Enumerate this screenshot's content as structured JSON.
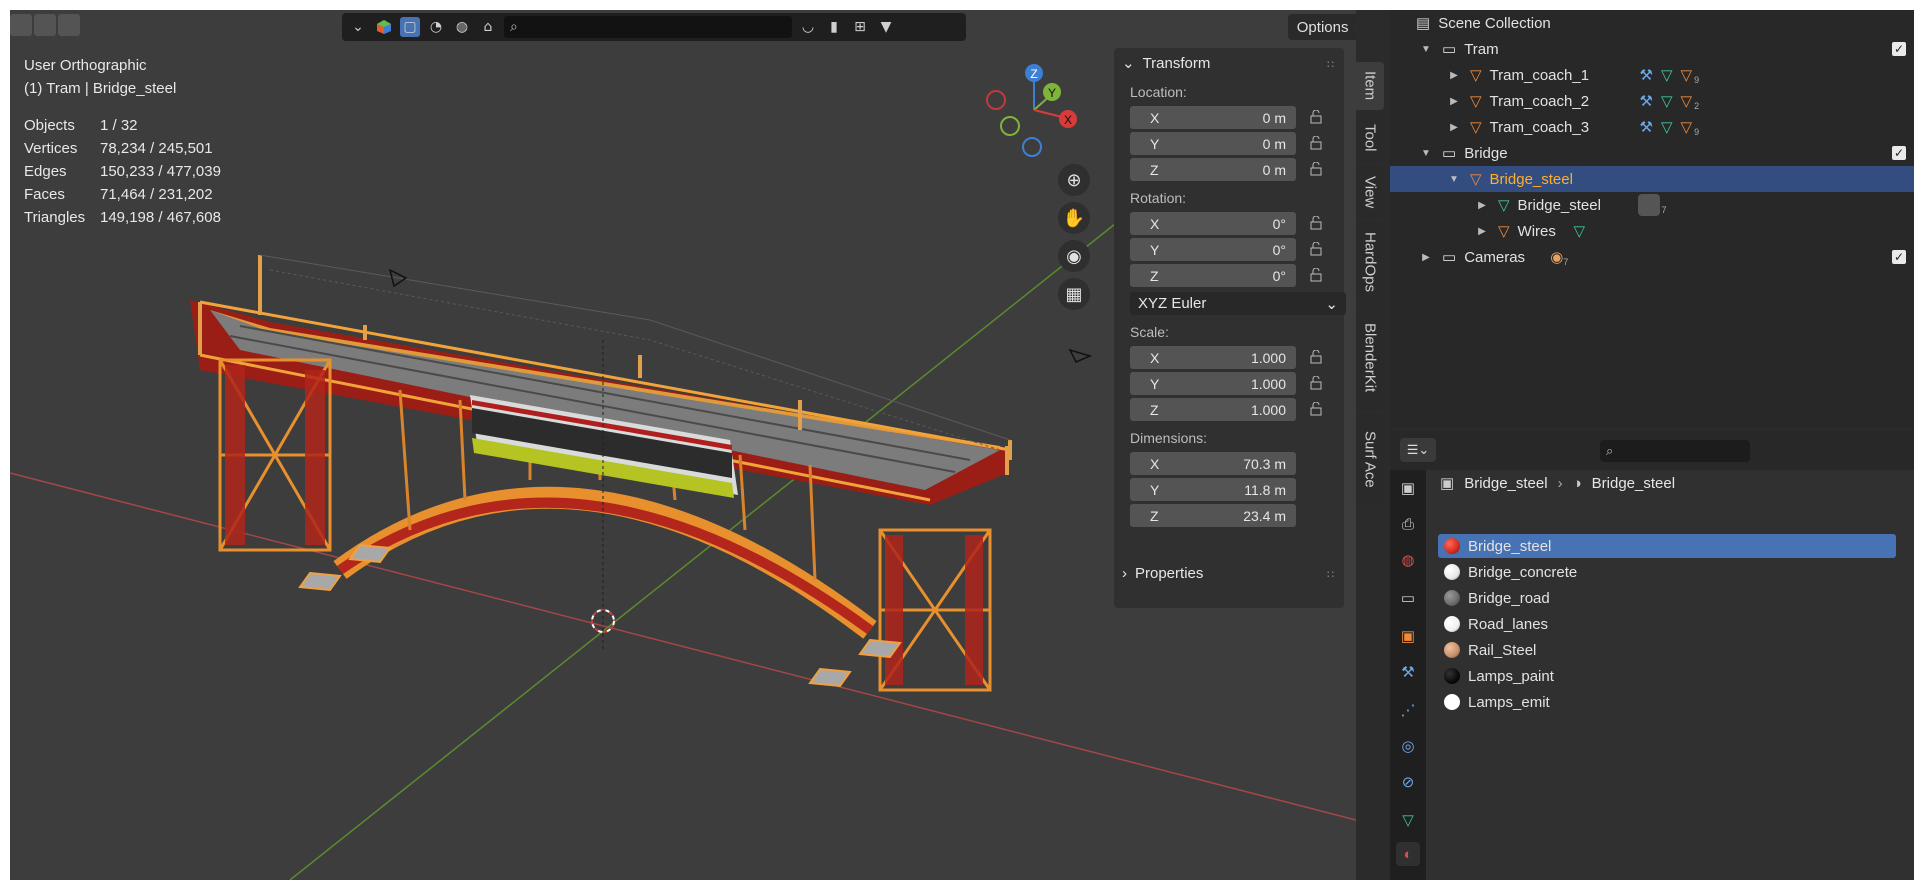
{
  "viewport": {
    "view_name": "User Orthographic",
    "context": "(1) Tram | Bridge_steel",
    "stats": [
      {
        "label": "Objects",
        "value": "1 / 32"
      },
      {
        "label": "Vertices",
        "value": "78,234 / 245,501"
      },
      {
        "label": "Edges",
        "value": "150,233 / 477,039"
      },
      {
        "label": "Faces",
        "value": "71,464 / 231,202"
      },
      {
        "label": "Triangles",
        "value": "149,198 / 467,608"
      }
    ],
    "options_label": "Options",
    "gizmo_axes": {
      "z": "Z",
      "y": "Y",
      "x": "X"
    }
  },
  "npanel": {
    "transform_title": "Transform",
    "location_label": "Location:",
    "location": [
      {
        "axis": "X",
        "value": "0 m"
      },
      {
        "axis": "Y",
        "value": "0 m"
      },
      {
        "axis": "Z",
        "value": "0 m"
      }
    ],
    "rotation_label": "Rotation:",
    "rotation": [
      {
        "axis": "X",
        "value": "0°"
      },
      {
        "axis": "Y",
        "value": "0°"
      },
      {
        "axis": "Z",
        "value": "0°"
      }
    ],
    "rotation_mode": "XYZ Euler",
    "scale_label": "Scale:",
    "scale": [
      {
        "axis": "X",
        "value": "1.000"
      },
      {
        "axis": "Y",
        "value": "1.000"
      },
      {
        "axis": "Z",
        "value": "1.000"
      }
    ],
    "dimensions_label": "Dimensions:",
    "dimensions": [
      {
        "axis": "X",
        "value": "70.3 m"
      },
      {
        "axis": "Y",
        "value": "11.8 m"
      },
      {
        "axis": "Z",
        "value": "23.4 m"
      }
    ],
    "properties_title": "Properties",
    "tabs": [
      "Item",
      "Tool",
      "View",
      "HardOps",
      "BlenderKit",
      "Surf Ace"
    ]
  },
  "outliner": {
    "root": "Scene Collection",
    "rows": [
      {
        "label": "Tram",
        "sub": ""
      },
      {
        "label": "Tram_coach_1",
        "sub": "9"
      },
      {
        "label": "Tram_coach_2",
        "sub": "2"
      },
      {
        "label": "Tram_coach_3",
        "sub": "9"
      },
      {
        "label": "Bridge",
        "sub": ""
      },
      {
        "label": "Bridge_steel",
        "sub": ""
      },
      {
        "label": "Bridge_steel",
        "sub": "7"
      },
      {
        "label": "Wires",
        "sub": ""
      },
      {
        "label": "Cameras",
        "sub": "7"
      }
    ]
  },
  "properties": {
    "breadcrumb_object": "Bridge_steel",
    "breadcrumb_material": "Bridge_steel",
    "materials": [
      {
        "name": "Bridge_steel",
        "color": "#d42a1c"
      },
      {
        "name": "Bridge_concrete",
        "color": "#e8e8e8"
      },
      {
        "name": "Bridge_road",
        "color": "#6a6a6a"
      },
      {
        "name": "Road_lanes",
        "color": "#f0f0f0"
      },
      {
        "name": "Rail_Steel",
        "color": "#c7906a"
      },
      {
        "name": "Lamps_paint",
        "color": "#0a0a0a"
      },
      {
        "name": "Lamps_emit",
        "color": "#ffffff"
      }
    ]
  },
  "colors": {
    "selection_orange": "#ffaf29",
    "selected_row": "#334d80",
    "selected_material": "#4772b3",
    "bridge_red": "#c0281c"
  }
}
